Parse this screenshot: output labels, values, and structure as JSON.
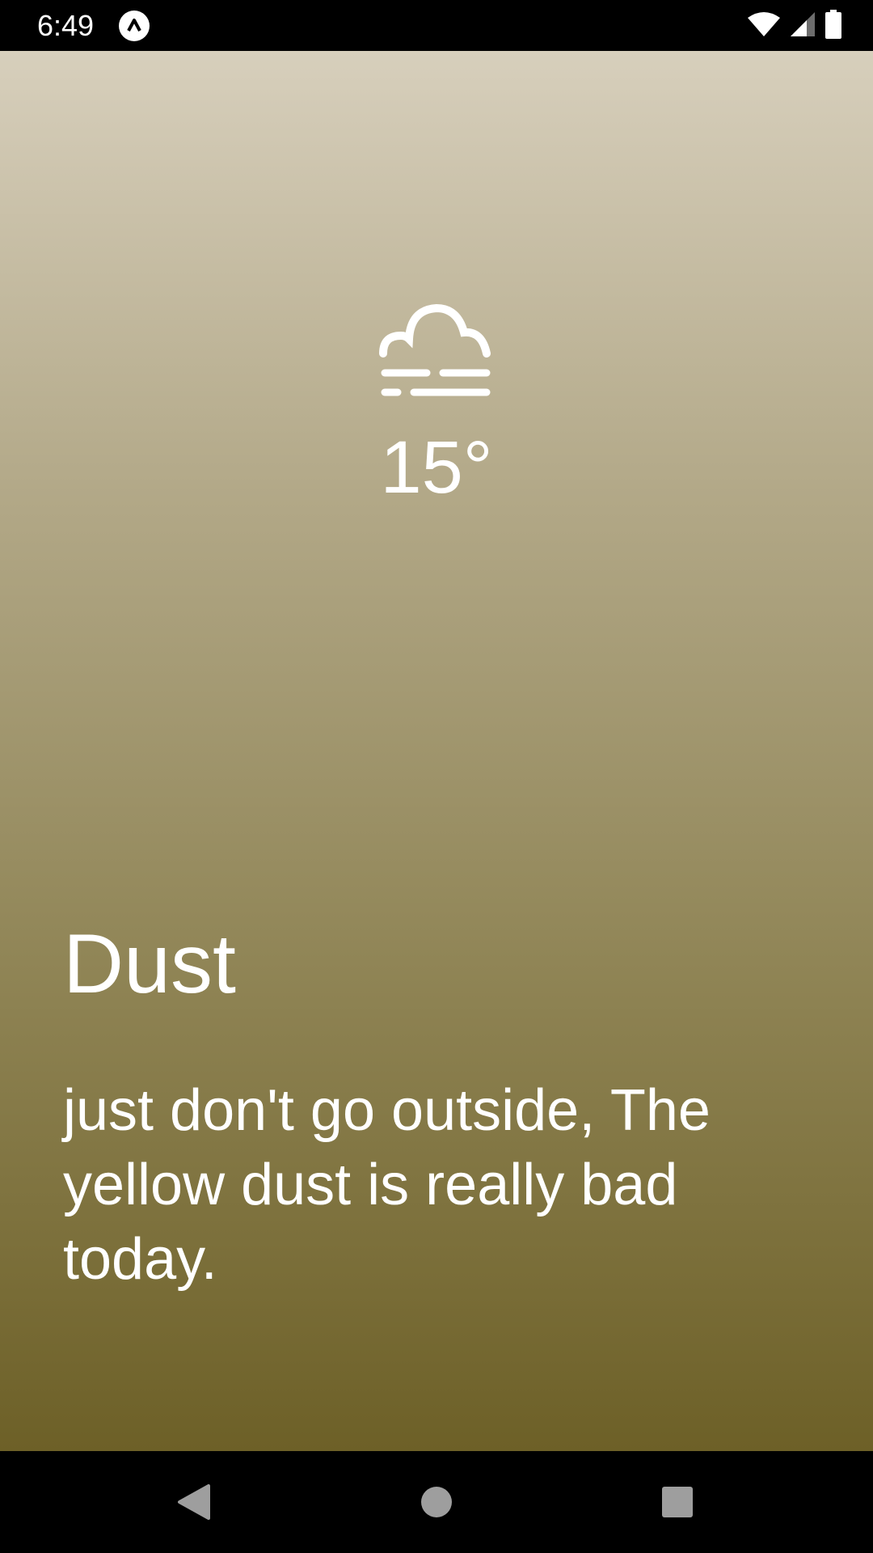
{
  "status_bar": {
    "time": "6:49",
    "app_icon": "app-notification-icon",
    "icons": [
      "wifi-icon",
      "signal-icon",
      "battery-icon"
    ]
  },
  "weather": {
    "icon": "fog-cloud-icon",
    "temperature": "15°",
    "title": "Dust",
    "subtitle": "just don't go outside, The yellow dust is really bad today."
  },
  "colors": {
    "gradient_top": "#d7cfbc",
    "gradient_bottom": "#6d6027",
    "text": "#ffffff",
    "system_bars": "#000000"
  },
  "navigation": {
    "buttons": [
      "back-icon",
      "home-icon",
      "recents-icon"
    ]
  }
}
